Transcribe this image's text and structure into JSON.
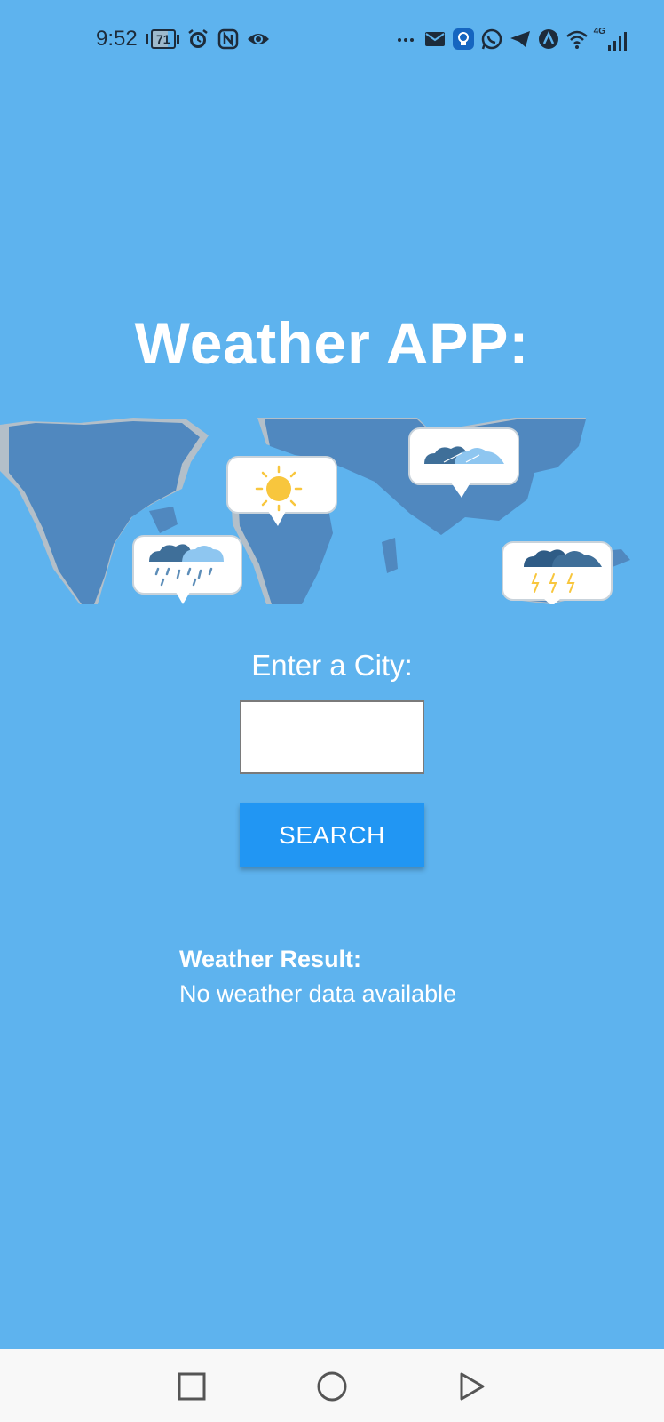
{
  "status_bar": {
    "time": "9:52",
    "battery_level": "71",
    "network_label": "4G",
    "left_icons": [
      "battery-icon",
      "alarm-icon",
      "nfc-icon",
      "eye-icon"
    ],
    "right_icons": [
      "more-icon",
      "mail-icon",
      "bulb-icon",
      "whatsapp-icon",
      "telegram-icon",
      "app-icon",
      "wifi-icon",
      "signal-icon"
    ]
  },
  "app": {
    "title": "Weather APP:"
  },
  "map": {
    "weather_bubbles": [
      "rain-icon",
      "sun-icon",
      "cloud-icon",
      "storm-icon"
    ]
  },
  "form": {
    "city_label": "Enter a City:",
    "city_value": "",
    "city_placeholder": "",
    "search_label": "SEARCH"
  },
  "result": {
    "heading": "Weather Result:",
    "text": "No weather data available"
  },
  "nav_bar": {
    "buttons": [
      "recent-apps-icon",
      "home-icon",
      "back-icon"
    ]
  },
  "colors": {
    "background": "#5eb3ee",
    "button": "#2196f3",
    "map_land": "#5088bf",
    "map_shadow": "#b3bfc9",
    "nav_background": "#f8f8f8"
  }
}
